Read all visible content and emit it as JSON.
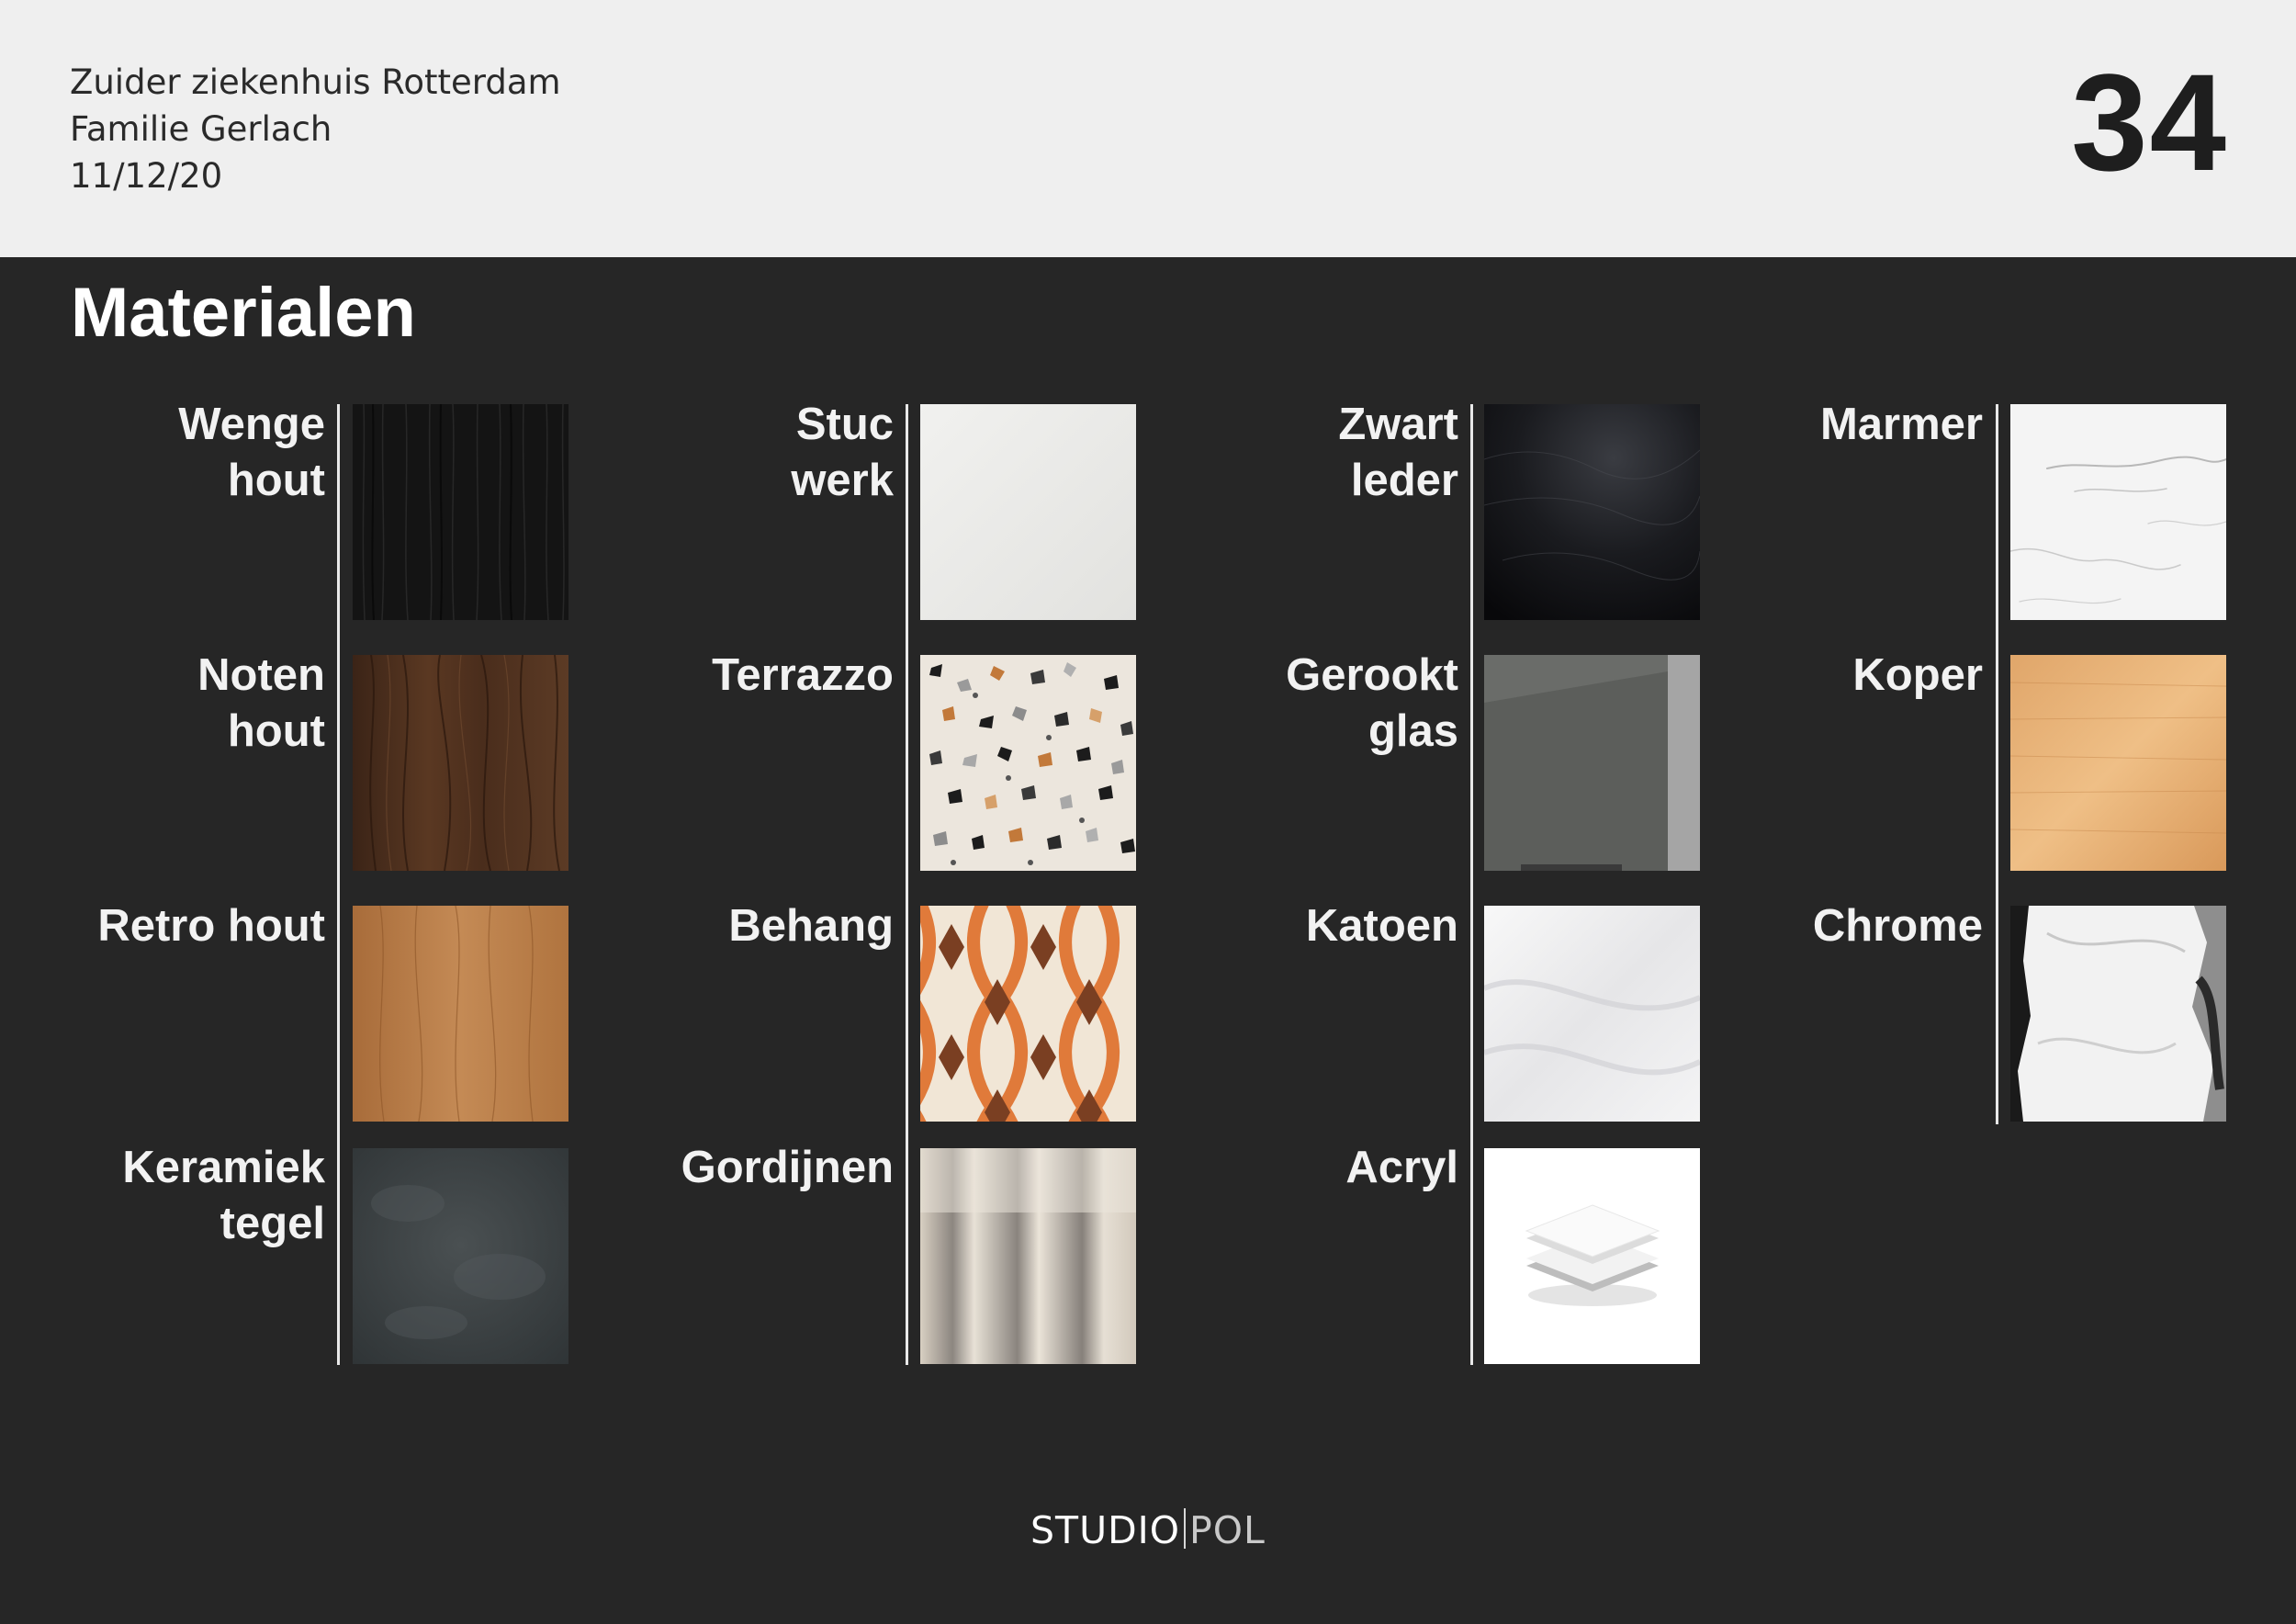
{
  "header": {
    "line1": "Zuider ziekenhuis Rotterdam",
    "line2": "Familie Gerlach",
    "line3": "11/12/20",
    "page_number": "34"
  },
  "title": "Materialen",
  "materials": [
    {
      "line1": "Wenge",
      "line2": "hout",
      "swatch": "wenge-wood"
    },
    {
      "line1": "Stuc",
      "line2": "werk",
      "swatch": "stucco"
    },
    {
      "line1": "Zwart",
      "line2": "leder",
      "swatch": "black-leather"
    },
    {
      "line1": "Marmer",
      "line2": "",
      "swatch": "marble"
    },
    {
      "line1": "Noten",
      "line2": "hout",
      "swatch": "walnut-wood"
    },
    {
      "line1": "Terrazzo",
      "line2": "",
      "swatch": "terrazzo"
    },
    {
      "line1": "Gerookt",
      "line2": "glas",
      "swatch": "smoked-glass"
    },
    {
      "line1": "Koper",
      "line2": "",
      "swatch": "copper"
    },
    {
      "line1": "Retro hout",
      "line2": "",
      "swatch": "retro-wood"
    },
    {
      "line1": "Behang",
      "line2": "",
      "swatch": "retro-wallpaper"
    },
    {
      "line1": "Katoen",
      "line2": "",
      "swatch": "cotton"
    },
    {
      "line1": "Chrome",
      "line2": "",
      "swatch": "chrome"
    },
    {
      "line1": "Keramiek",
      "line2": "tegel",
      "swatch": "ceramic-tile"
    },
    {
      "line1": "Gordijnen",
      "line2": "",
      "swatch": "curtains"
    },
    {
      "line1": "Acryl",
      "line2": "",
      "swatch": "acrylic"
    }
  ],
  "logo": {
    "part1": "STUDIO",
    "part2": "POL"
  }
}
